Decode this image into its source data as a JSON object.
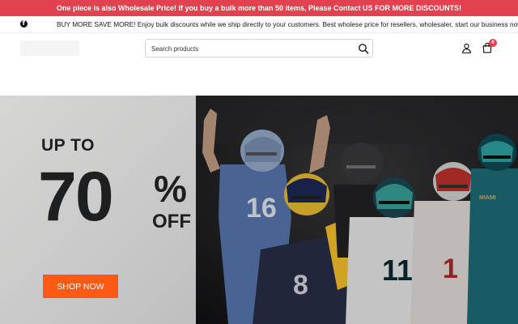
{
  "announcement": {
    "text": "One piece is also Wholesale Price! If you buy a bulk more than 50 items, Please Contact US FOR MORE DISCOUNTS!"
  },
  "info_bar": {
    "text": "BUY MORE SAVE MORE! Enjoy bulk discounts while we ship directly to your customers. Best wholese price for resellers, wholesaler, start our business now!",
    "social_icon": "facebook-icon"
  },
  "header": {
    "search": {
      "placeholder": "Search products",
      "icon": "search-icon"
    },
    "account_icon": "user-icon",
    "cart": {
      "icon": "shopping-bag-icon",
      "count": "0"
    }
  },
  "hero": {
    "line1": "UP TO",
    "percent": "70",
    "percent_sign": "%",
    "off": "OFF",
    "cta_label": "SHOP NOW",
    "jersey_numbers": [
      "16",
      "8",
      "11",
      "1"
    ],
    "photo_caption": "MIAMI"
  },
  "colors": {
    "announcement_bg": "#e2424f",
    "cta_bg": "#ff5a14",
    "hero_left_bg": "#cfcfcf",
    "text_dark": "#1d1f21"
  }
}
